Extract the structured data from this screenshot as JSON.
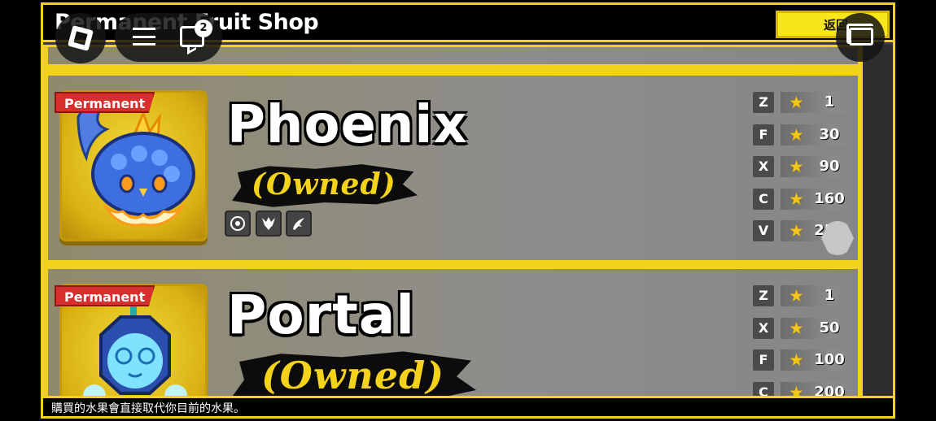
{
  "shop": {
    "title": "Permanent Fruit Shop",
    "back_label": "返回"
  },
  "roblox_overlay": {
    "chat_unread_count": "2",
    "icons": [
      "roblox-logo-icon",
      "hamburger-menu-icon",
      "chat-icon",
      "window-switch-icon"
    ]
  },
  "fruits": [
    {
      "tag": "Permanent",
      "name": "Phoenix",
      "status": "(Owned)",
      "badges": [
        "eye-icon",
        "dragon-icon",
        "sword-icon"
      ],
      "moves": [
        {
          "key": "Z",
          "level": "1"
        },
        {
          "key": "F",
          "level": "30"
        },
        {
          "key": "X",
          "level": "90"
        },
        {
          "key": "C",
          "level": "160"
        },
        {
          "key": "V",
          "level": "250"
        }
      ]
    },
    {
      "tag": "Permanent",
      "name": "Portal",
      "status": "(Owned)",
      "moves": [
        {
          "key": "Z",
          "level": "1"
        },
        {
          "key": "X",
          "level": "50"
        },
        {
          "key": "F",
          "level": "100"
        },
        {
          "key": "C",
          "level": "200"
        }
      ]
    }
  ],
  "footer": {
    "notice": "購買的水果會直接取代你目前的水果。"
  },
  "colors": {
    "border": "#f2d21a",
    "owned_text": "#f6d31b",
    "permanent_tag": "#d72e2e",
    "star": "#f4c61a"
  }
}
